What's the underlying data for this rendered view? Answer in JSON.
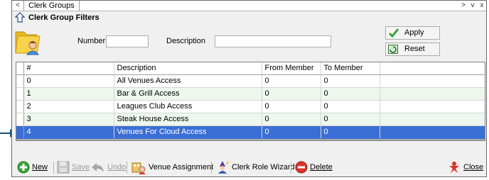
{
  "window": {
    "tab_label": "Clerk Groups",
    "nav_left": "<",
    "controls": [
      ">",
      "v",
      "x"
    ]
  },
  "filters": {
    "title": "Clerk Group Filters",
    "number_label": "Number",
    "number_value": "",
    "description_label": "Description",
    "description_value": "",
    "apply_label": "Apply",
    "reset_label": "Reset"
  },
  "grid": {
    "columns": [
      "#",
      "Description",
      "From Member",
      "To Member"
    ],
    "rows": [
      {
        "num": "0",
        "description": "All Venues Access",
        "from": "0",
        "to": "0"
      },
      {
        "num": "1",
        "description": "Bar & Grill Access",
        "from": "0",
        "to": "0"
      },
      {
        "num": "2",
        "description": "Leagues Club Access",
        "from": "0",
        "to": "0"
      },
      {
        "num": "3",
        "description": "Steak House Access",
        "from": "0",
        "to": "0"
      },
      {
        "num": "4",
        "description": "Venues For Cloud Access",
        "from": "0",
        "to": "0"
      }
    ],
    "selected_row": 4
  },
  "toolbar": {
    "new_label": "New",
    "save_label": "Save",
    "undo_label": "Undo",
    "venue_assignment_label": "Venue Assignment",
    "clerk_role_wizard_label": "Clerk Role Wizard",
    "delete_label": "Delete",
    "close_label": "Close"
  },
  "colors": {
    "selection": "#3b6fd6",
    "alt_row": "#eef7ee",
    "accent_green": "#3aa53a",
    "accent_red": "#d9342b"
  }
}
